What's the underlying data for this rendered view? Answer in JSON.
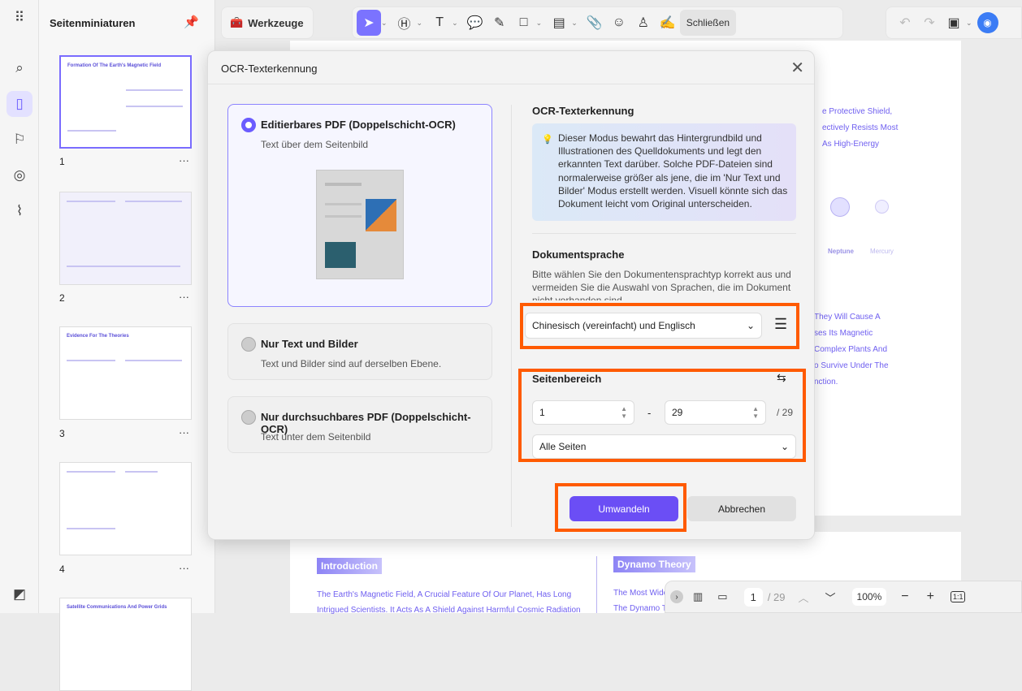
{
  "rail": {
    "icons": [
      "apps-icon",
      "search-icon",
      "pages-icon",
      "bookmark-icon",
      "comment-icon",
      "attachment-icon",
      "layers-icon"
    ]
  },
  "thumbs": {
    "title": "Seitenminiaturen",
    "pages": [
      {
        "num": "1",
        "title": "Formation Of The Earth's Magnetic Field"
      },
      {
        "num": "2",
        "title": ""
      },
      {
        "num": "3",
        "title": "Evidence For The Theories"
      },
      {
        "num": "4",
        "title": ""
      },
      {
        "num": "5",
        "title": "Satellite Communications And Power Grids"
      }
    ],
    "more": "···"
  },
  "toolbar": {
    "tools_label": "Werkzeuge",
    "close_label": "Schließen"
  },
  "document": {
    "right_lines": [
      "e Protective Shield,",
      "ectively Resists Most",
      "As High-Energy"
    ],
    "planets": [
      "Neptune",
      "Mercury"
    ],
    "right_lines2": [
      "They Will Cause A",
      "ses Its Magnetic",
      "Complex Plants And",
      "o Survive Under The",
      "nction."
    ],
    "intro": "Introduction",
    "dynamo": "Dynamo Theory",
    "intro_lines": [
      "The Earth's Magnetic Field, A Crucial Feature Of Our Planet, Has Long",
      "Intrigued Scientists. It Acts As A Shield Against Harmful Cosmic Radiation"
    ],
    "dynamo_lines": [
      "The Most Wide",
      "The Dynamo T"
    ]
  },
  "dialog": {
    "title": "OCR-Texterkennung",
    "options": [
      {
        "label": "Editierbares PDF (Doppelschicht-OCR)",
        "sub": "Text über dem Seitenbild",
        "selected": true
      },
      {
        "label": "Nur Text und Bilder",
        "sub": "Text und Bilder sind auf derselben Ebene.",
        "selected": false
      },
      {
        "label": "Nur durchsuchbares PDF (Doppelschicht-OCR)",
        "sub": "Text unter dem Seitenbild",
        "selected": false
      }
    ],
    "section_title": "OCR-Texterkennung",
    "info": "Dieser Modus bewahrt das Hintergrundbild und Illustrationen des Quelldokuments und legt den erkannten Text darüber. Solche PDF-Dateien sind normalerweise größer als jene, die im 'Nur Text und Bilder' Modus erstellt werden. Visuell könnte sich das Dokument leicht vom Original unterscheiden.",
    "lang_title": "Dokumentsprache",
    "lang_desc": "Bitte wählen Sie den Dokumentensprachtyp korrekt aus und vermeiden Sie die Auswahl von Sprachen, die im Dokument nicht vorhanden sind.",
    "lang_value": "Chinesisch (vereinfacht) und Englisch",
    "range_title": "Seitenbereich",
    "from": "1",
    "dash": "-",
    "to": "29",
    "total": "/ 29",
    "range_value": "Alle Seiten",
    "convert": "Umwandeln",
    "cancel": "Abbrechen"
  },
  "bottombar": {
    "page": "1",
    "total": "/ 29",
    "zoom": "100%",
    "fit": "1:1"
  },
  "colors": {
    "accent": "#6b4ef5",
    "highlight": "#ff5a00"
  }
}
